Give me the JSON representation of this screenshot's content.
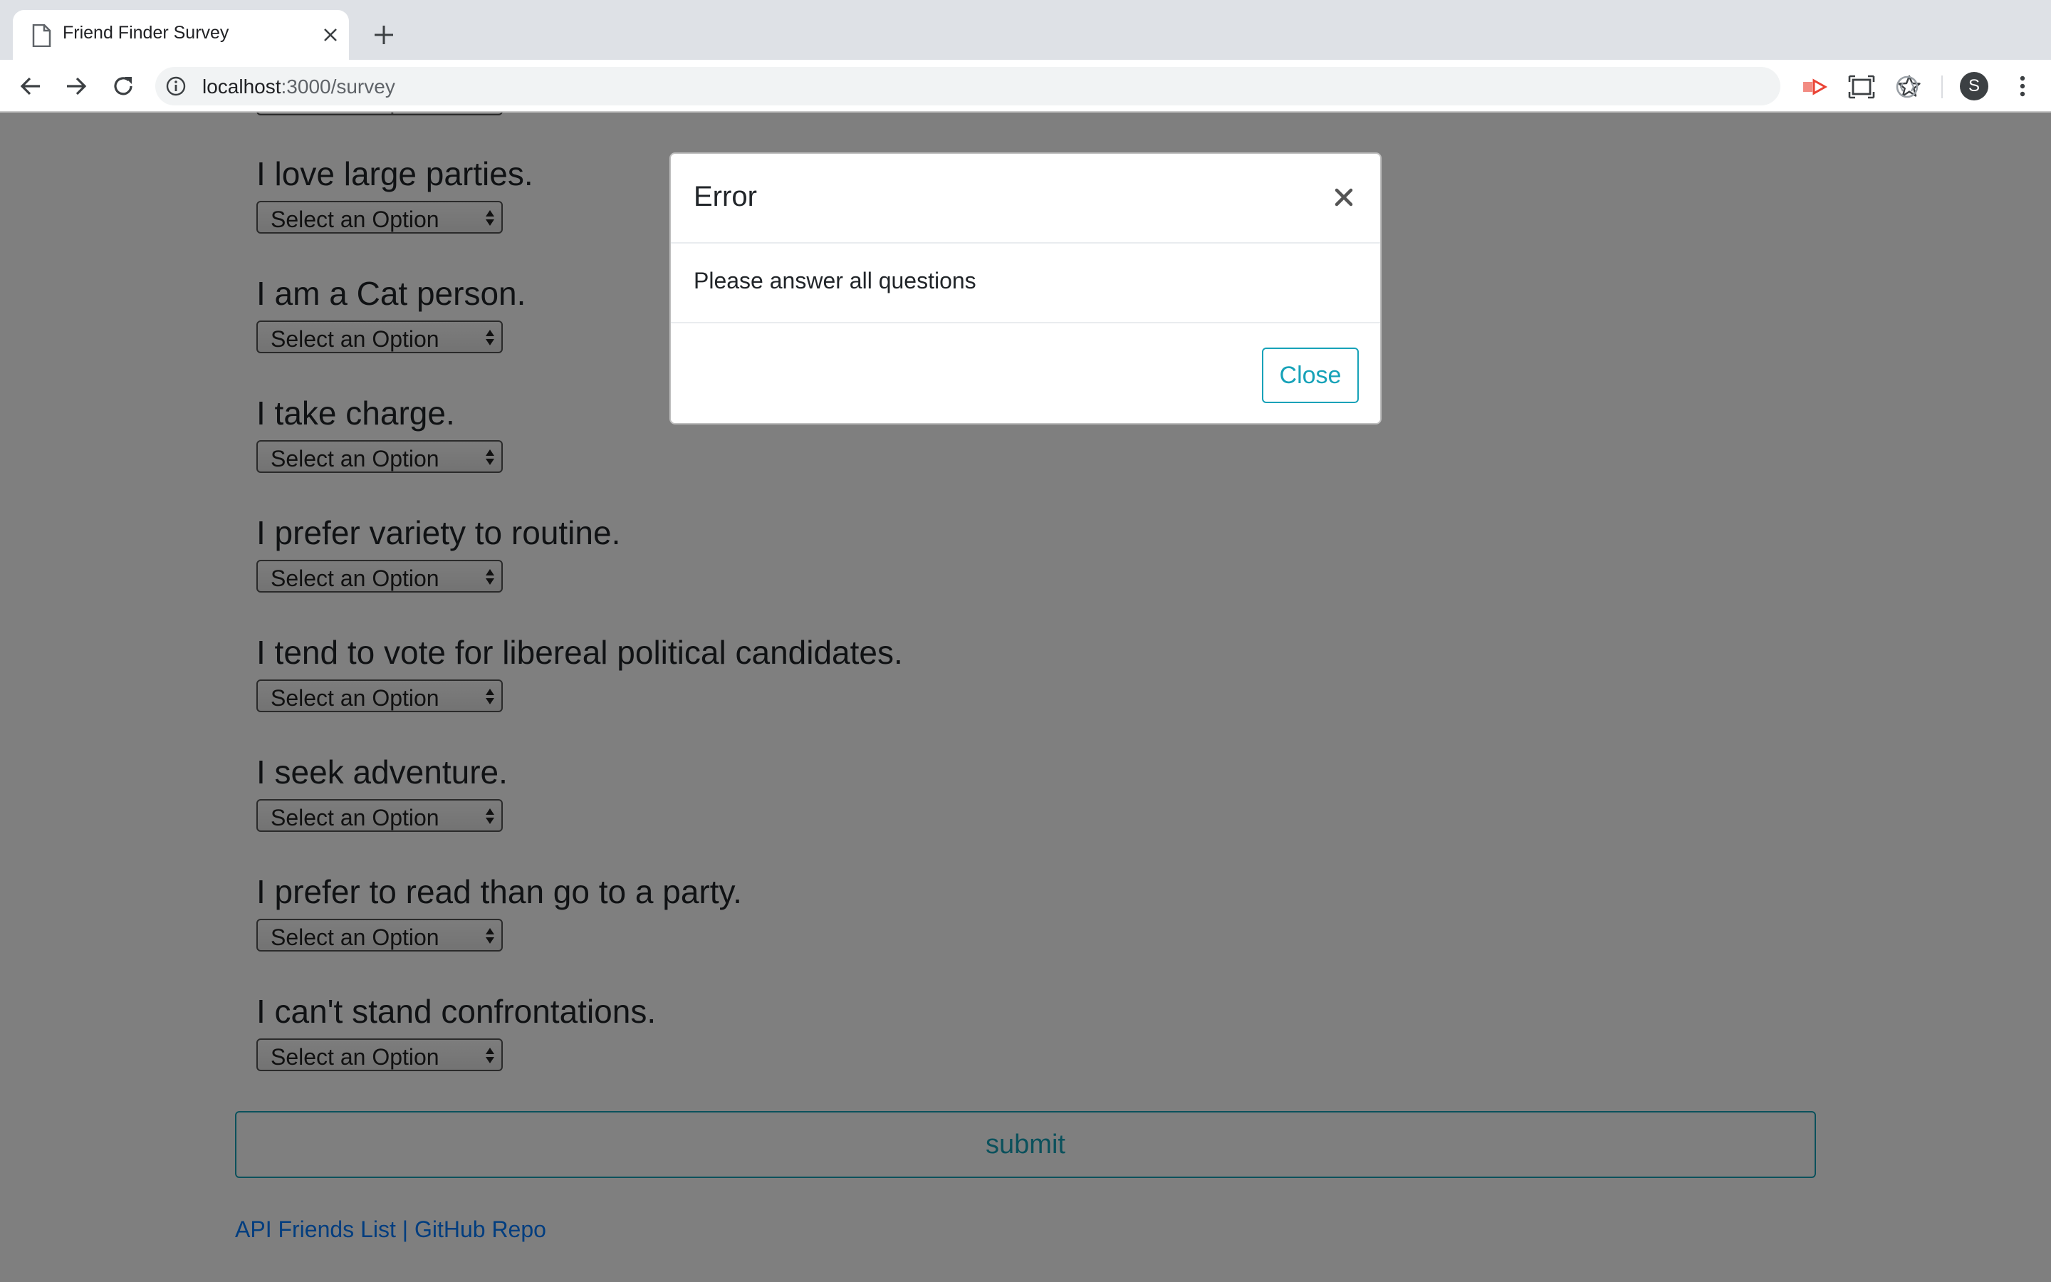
{
  "browser": {
    "tab_title": "Friend Finder Survey",
    "url_host": "localhost",
    "url_path": ":3000/survey",
    "profile_initial": "S"
  },
  "survey": {
    "select_placeholder": "Select an Option",
    "questions": [
      {
        "text": "I love large parties."
      },
      {
        "text": "I am a Cat person."
      },
      {
        "text": "I take charge."
      },
      {
        "text": "I prefer variety to routine."
      },
      {
        "text": "I tend to vote for libereal political candidates."
      },
      {
        "text": "I seek adventure."
      },
      {
        "text": "I prefer to read than go to a party."
      },
      {
        "text": "I can't stand confrontations."
      }
    ],
    "submit_label": "submit"
  },
  "footer": {
    "api_link": "API Friends List",
    "separator": "|",
    "github_link": "GitHub Repo"
  },
  "modal": {
    "title": "Error",
    "message": "Please answer all questions",
    "close_label": "Close"
  },
  "colors": {
    "accent": "#17a2b8",
    "link": "#007bff",
    "backdrop": "rgba(0,0,0,0.5)"
  }
}
